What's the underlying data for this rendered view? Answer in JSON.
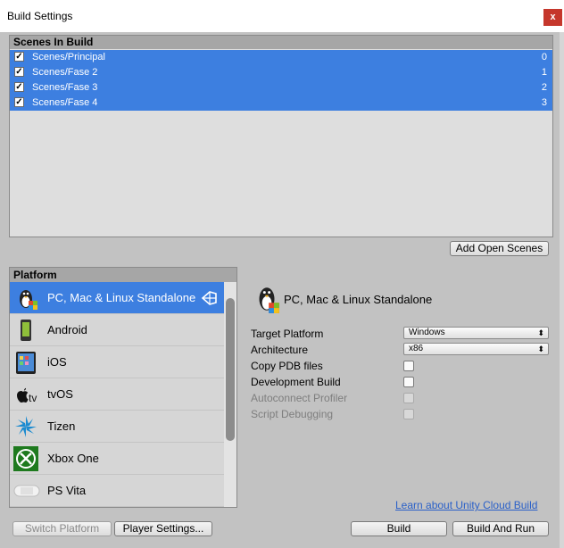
{
  "window": {
    "title": "Build Settings",
    "close_glyph": "x"
  },
  "scenes": {
    "header": "Scenes In Build",
    "items": [
      {
        "name": "Scenes/Principal",
        "index": "0",
        "checked": true
      },
      {
        "name": "Scenes/Fase 2",
        "index": "1",
        "checked": true
      },
      {
        "name": "Scenes/Fase 3",
        "index": "2",
        "checked": true
      },
      {
        "name": "Scenes/Fase 4",
        "index": "3",
        "checked": true
      }
    ],
    "add_open_scenes_label": "Add Open Scenes"
  },
  "platform": {
    "header": "Platform",
    "items": [
      {
        "label": "PC, Mac & Linux Standalone",
        "icon": "linux-penguin-icon",
        "selected": true
      },
      {
        "label": "Android",
        "icon": "android-phone-icon",
        "selected": false
      },
      {
        "label": "iOS",
        "icon": "ipad-icon",
        "selected": false
      },
      {
        "label": "tvOS",
        "icon": "apple-tv-icon",
        "selected": false
      },
      {
        "label": "Tizen",
        "icon": "tizen-icon",
        "selected": false
      },
      {
        "label": "Xbox One",
        "icon": "xbox-icon",
        "selected": false
      },
      {
        "label": "PS Vita",
        "icon": "ps-vita-icon",
        "selected": false
      }
    ]
  },
  "settings": {
    "platform_title": "PC, Mac & Linux Standalone",
    "target_platform_label": "Target Platform",
    "target_platform_value": "Windows",
    "architecture_label": "Architecture",
    "architecture_value": "x86",
    "copy_pdb_label": "Copy PDB files",
    "development_build_label": "Development Build",
    "autoconnect_profiler_label": "Autoconnect Profiler",
    "script_debugging_label": "Script Debugging",
    "cloud_build_link": "Learn about Unity Cloud Build"
  },
  "buttons": {
    "switch_platform": "Switch Platform",
    "player_settings": "Player Settings...",
    "build": "Build",
    "build_and_run": "Build And Run"
  },
  "colors": {
    "selection": "#3d7fe0",
    "link": "#2a60c8",
    "close": "#c5372c"
  }
}
